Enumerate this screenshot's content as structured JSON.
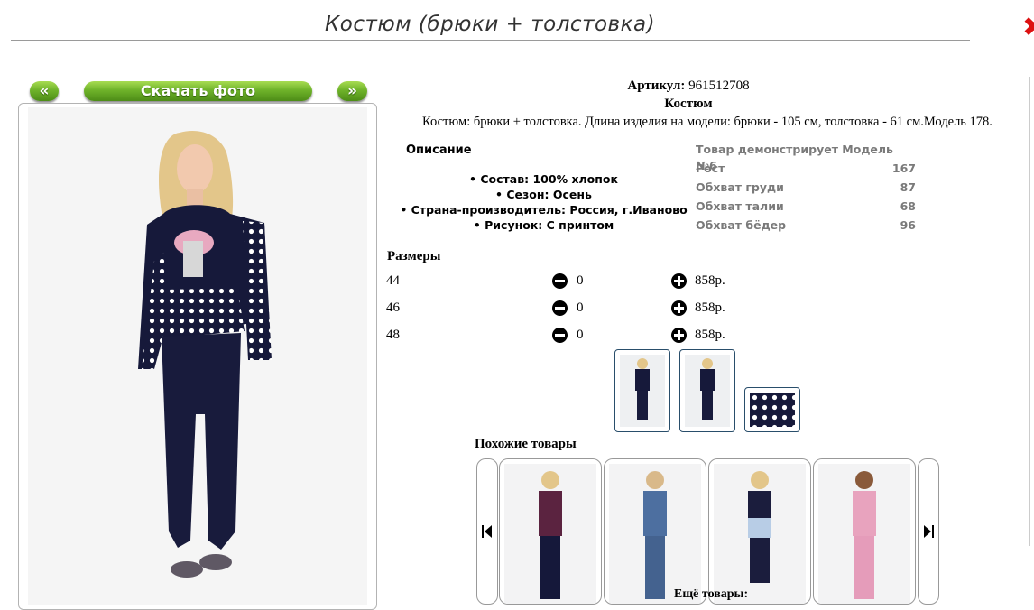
{
  "page_title": "Костюм (брюки + толстовка)",
  "nav": {
    "prev": "«",
    "download": "Скачать фото",
    "next": "»"
  },
  "product": {
    "sku_label": "Артикул:",
    "sku_value": "961512708",
    "type": "Костюм",
    "description": "Костюм: брюки + толстовка. Длина изделия на модели: брюки - 105 см, толстовка - 61 см.Модель 178."
  },
  "description_block": {
    "label": "Описание",
    "features": [
      "• Состав: 100% хлопок",
      "• Сезон: Осень",
      "• Страна-производитель: Россия, г.Иваново",
      "• Рисунок: С принтом"
    ]
  },
  "model_info": {
    "title": "Товар демонстрирует Модель №6",
    "rows": [
      {
        "label": "Рост",
        "value": "167"
      },
      {
        "label": "Обхват груди",
        "value": "87"
      },
      {
        "label": "Обхват талии",
        "value": "68"
      },
      {
        "label": "Обхват бёдер",
        "value": "96"
      }
    ]
  },
  "sizes": {
    "label": "Размеры",
    "rows": [
      {
        "size": "44",
        "qty": "0",
        "price": "858р."
      },
      {
        "size": "46",
        "qty": "0",
        "price": "858р."
      },
      {
        "size": "48",
        "qty": "0",
        "price": "858р."
      }
    ]
  },
  "similar": {
    "label": "Похожие товары"
  },
  "more": {
    "label": "Ещё товары:"
  },
  "icons": {
    "minus": "minus-circle-icon",
    "plus": "plus-circle-icon",
    "carousel_prev": "skip-back-icon",
    "carousel_next": "skip-forward-icon"
  },
  "colors": {
    "button_green": "#6fb32a",
    "close_red": "#dd1111",
    "thumb_border": "#294e6b",
    "muted_text": "#7a7a7a"
  }
}
